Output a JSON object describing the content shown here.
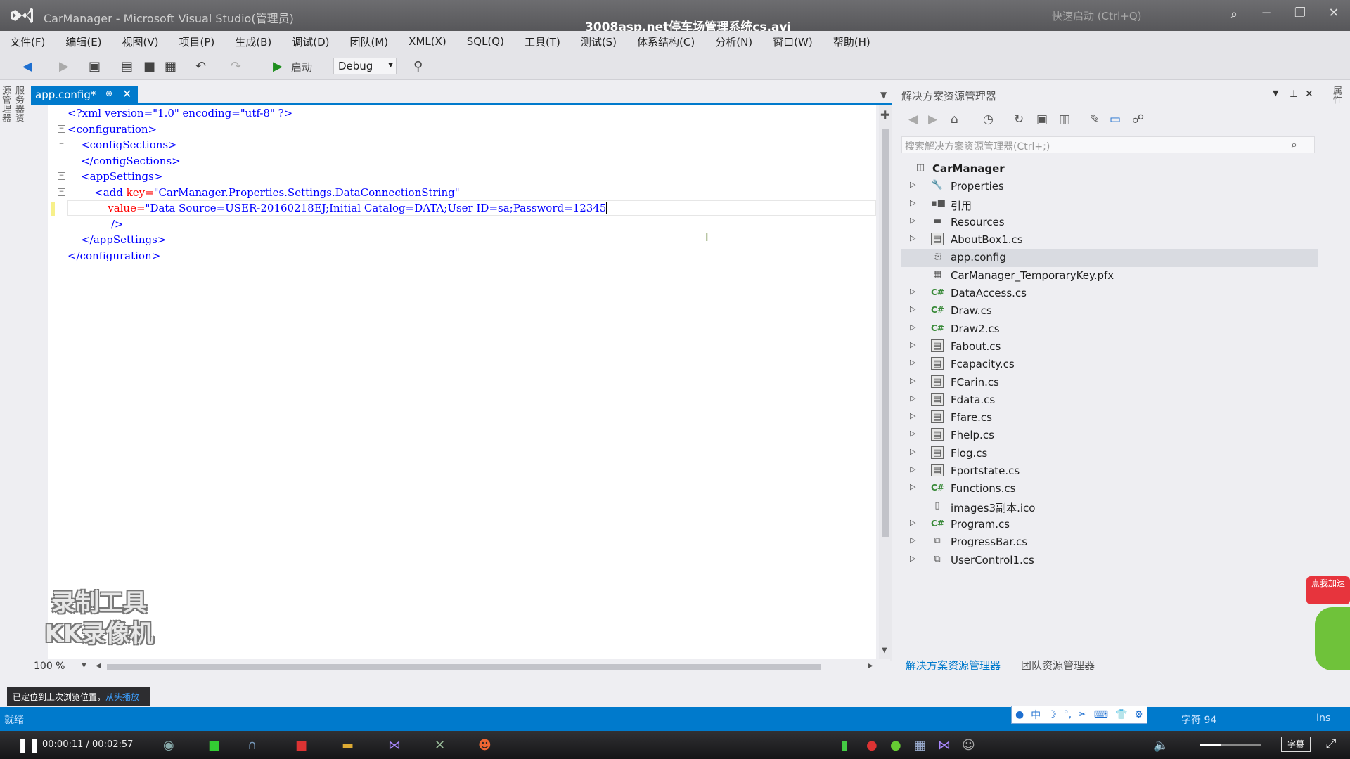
{
  "window": {
    "title": "CarManager - Microsoft Visual Studio(管理员)",
    "video_title": "3008asp.net停车场管理系统cs.avi",
    "quick_launch": "快速启动 (Ctrl+Q)",
    "min": "−",
    "max": "❐",
    "close": "✕"
  },
  "menu": [
    "文件(F)",
    "编辑(E)",
    "视图(V)",
    "项目(P)",
    "生成(B)",
    "调试(D)",
    "团队(M)",
    "XML(X)",
    "SQL(Q)",
    "工具(T)",
    "测试(S)",
    "体系结构(C)",
    "分析(N)",
    "窗口(W)",
    "帮助(H)"
  ],
  "toolbar": {
    "start_label": "启动",
    "config": "Debug"
  },
  "left_tabs": "服务器资源管理器",
  "right_tabs": "属性",
  "doc_tab": {
    "label": "app.config*",
    "pin": "⊕",
    "close": "✕"
  },
  "code": {
    "l1_pi": "<?xml version=\"1.0\" encoding=\"utf-8\" ?>",
    "l2": "<configuration>",
    "l3": "<configSections>",
    "l4": "</configSections>",
    "l5": "<appSettings>",
    "l6_tag": "<add ",
    "l6_attr": "key=",
    "l6_val": "\"CarManager.Properties.Settings.DataConnectionString\"",
    "l7_attr": "value=",
    "l7_val": "\"Data Source=USER-20160218EJ;Initial Catalog=DATA;User ID=sa;Password=12345",
    "l8": "/>",
    "l9": "</appSettings>",
    "l10": "</configuration>"
  },
  "editor": {
    "zoom": "100 %"
  },
  "solution_explorer": {
    "title": "解决方案资源管理器",
    "search_placeholder": "搜索解决方案资源管理器(Ctrl+;)",
    "root": "CarManager",
    "items": [
      {
        "label": "Properties",
        "icon": "wrench-icon",
        "expand": true
      },
      {
        "label": "引用",
        "icon": "references-icon",
        "expand": true
      },
      {
        "label": "Resources",
        "icon": "folder-icon",
        "expand": true
      },
      {
        "label": "AboutBox1.cs",
        "icon": "form-icon",
        "expand": true
      },
      {
        "label": "app.config",
        "icon": "config-icon",
        "expand": false,
        "selected": true
      },
      {
        "label": "CarManager_TemporaryKey.pfx",
        "icon": "certificate-icon",
        "expand": false
      },
      {
        "label": "DataAccess.cs",
        "icon": "csharp-icon",
        "expand": true
      },
      {
        "label": "Draw.cs",
        "icon": "csharp-icon",
        "expand": true
      },
      {
        "label": "Draw2.cs",
        "icon": "csharp-icon",
        "expand": true
      },
      {
        "label": "Fabout.cs",
        "icon": "form-icon",
        "expand": true
      },
      {
        "label": "Fcapacity.cs",
        "icon": "form-icon",
        "expand": true
      },
      {
        "label": "FCarin.cs",
        "icon": "form-icon",
        "expand": true
      },
      {
        "label": "Fdata.cs",
        "icon": "form-icon",
        "expand": true
      },
      {
        "label": "Ffare.cs",
        "icon": "form-icon",
        "expand": true
      },
      {
        "label": "Fhelp.cs",
        "icon": "form-icon",
        "expand": true
      },
      {
        "label": "Flog.cs",
        "icon": "form-icon",
        "expand": true
      },
      {
        "label": "Fportstate.cs",
        "icon": "form-icon",
        "expand": true
      },
      {
        "label": "Functions.cs",
        "icon": "csharp-icon",
        "expand": true
      },
      {
        "label": "images3副本.ico",
        "icon": "file-icon",
        "expand": false
      },
      {
        "label": "Program.cs",
        "icon": "csharp-icon",
        "expand": true
      },
      {
        "label": "ProgressBar.cs",
        "icon": "component-icon",
        "expand": true
      },
      {
        "label": "UserControl1.cs",
        "icon": "component-icon",
        "expand": true
      }
    ],
    "bottom_tabs": [
      "解决方案资源管理器",
      "团队资源管理器"
    ]
  },
  "watermark": {
    "line1": "录制工具",
    "line2": "KK录像机"
  },
  "toast": {
    "text": "已定位到上次浏览位置，",
    "link": "从头播放"
  },
  "status": {
    "left": "就绪",
    "col": "字符 94",
    "ins": "Ins"
  },
  "ime_icons": [
    "中",
    "☽",
    "°,",
    "✂",
    "⌨",
    "👕",
    "⚙"
  ],
  "side_ad": "点我加速",
  "player": {
    "time": "00:00:11 / 00:02:57",
    "volume_fraction": 0.35,
    "cc_label": "字幕"
  },
  "colors": {
    "accent": "#007acc",
    "keyword": "#0000ff",
    "attr": "#ff0000",
    "element": "#a31515"
  }
}
